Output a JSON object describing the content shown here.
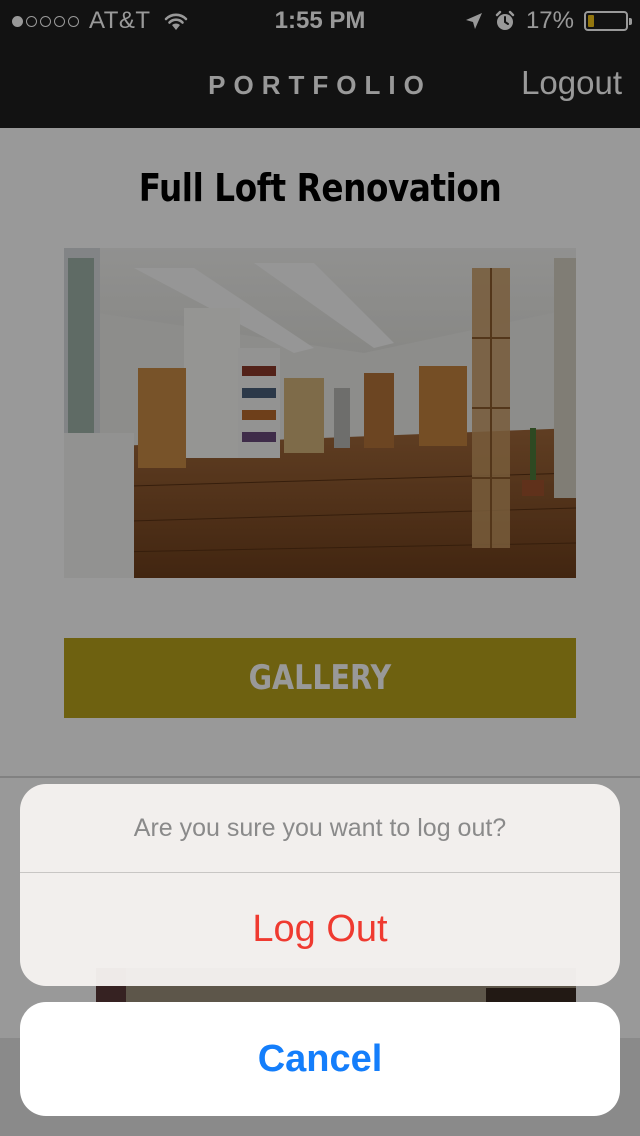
{
  "status_bar": {
    "signal_strength": 1,
    "carrier": "AT&T",
    "time": "1:55 PM",
    "battery_pct": "17%",
    "battery_level": 0.17,
    "icons": [
      "signal-dots-icon",
      "wifi-icon",
      "location-arrow-icon",
      "alarm-clock-icon",
      "battery-icon"
    ]
  },
  "nav": {
    "title": "PORTFOLIO",
    "logout_label": "Logout"
  },
  "project": {
    "title": "Full Loft Renovation",
    "gallery_label": "GALLERY"
  },
  "action_sheet": {
    "message": "Are you sure you want to log out?",
    "destructive_label": "Log Out",
    "cancel_label": "Cancel"
  },
  "colors": {
    "nav_background": "#1f1f1f",
    "gallery_button": "#b8a21c",
    "destructive_text": "#ef3a30",
    "cancel_text": "#147efb",
    "battery_fill": "#f5c518"
  }
}
